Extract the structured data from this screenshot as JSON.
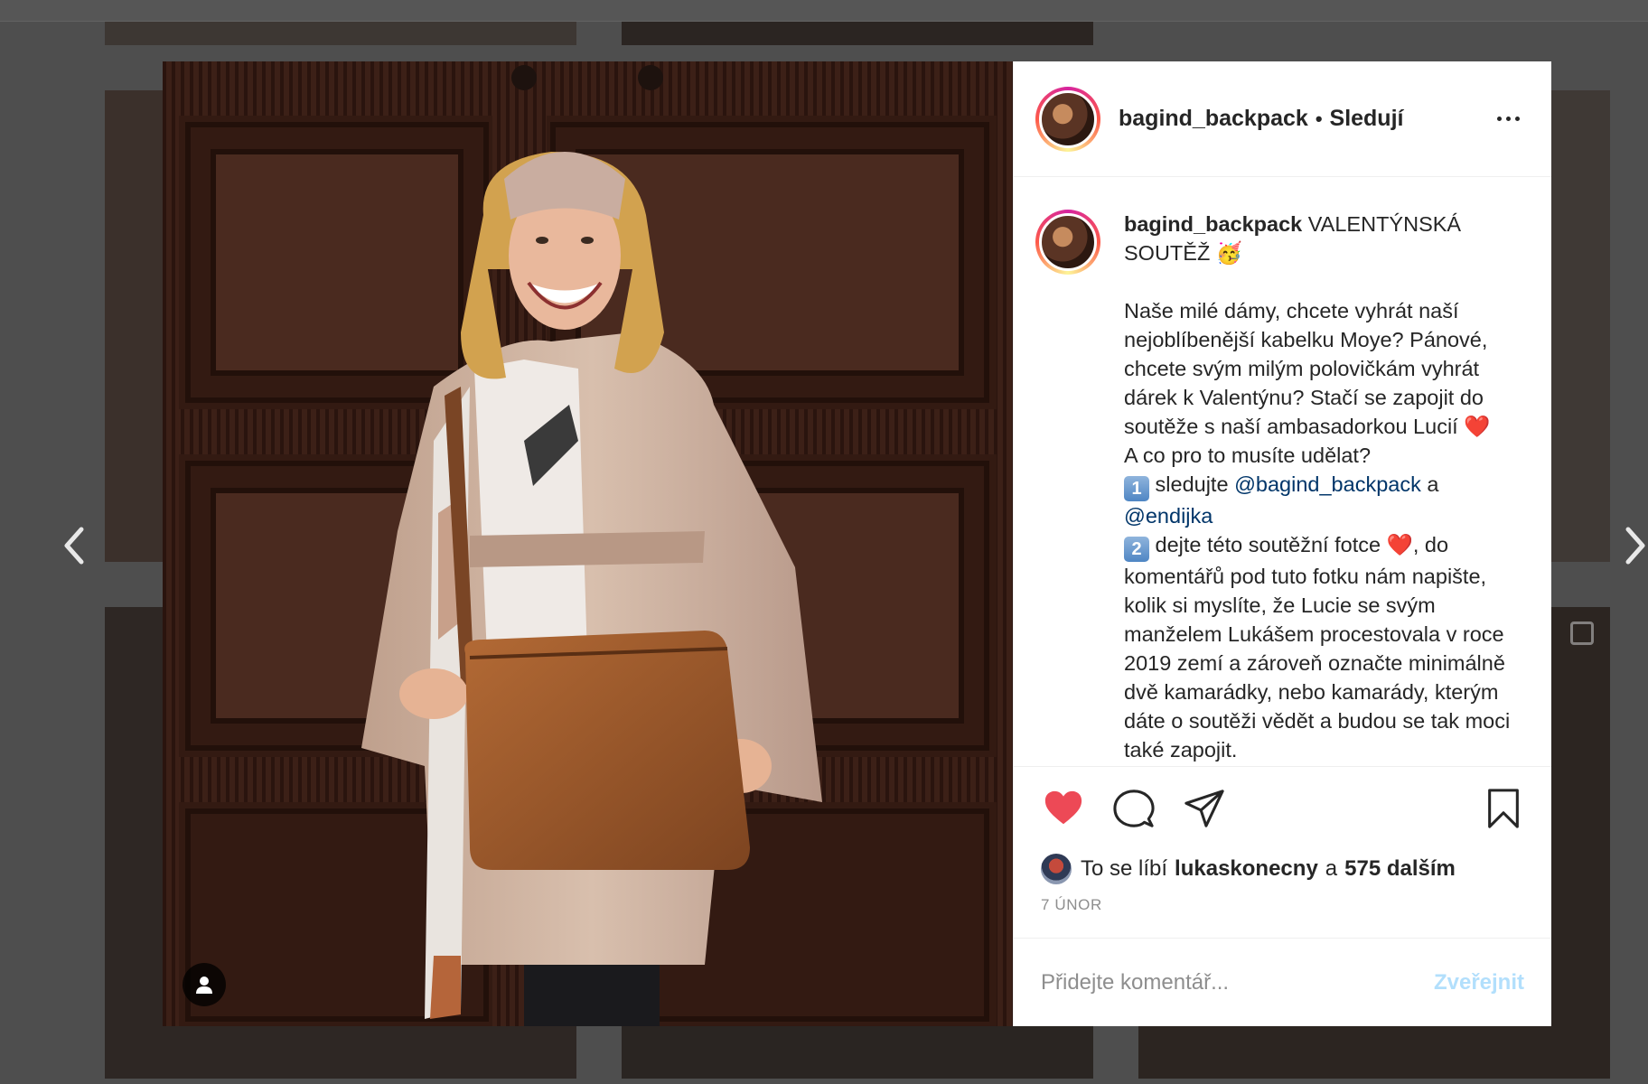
{
  "post": {
    "username": "bagind_backpack",
    "separator": "•",
    "follow_label": "Sledují",
    "caption_title": "VALENTÝNSKÁ SOUTĚŽ",
    "caption_title_emoji": "🥳",
    "caption_intro": "Naše milé dámy, chcete vyhrát naší nejoblíbenější kabelku Moye? Pánové, chcete svým milým polovičkám vyhrát dárek k Valentýnu? Stačí se zapojit do soutěže s naší ambasadorkou Lucií",
    "caption_question": "A co pro to musíte udělat?",
    "step1_key": "1",
    "step1_text": "sledujte",
    "step1_mention1": "@bagind_backpack",
    "step1_and": "a",
    "step1_mention2": "@endijka",
    "step2_key": "2",
    "step2_text_a": "dejte této soutěžní fotce",
    "step2_text_b": ", do komentářů pod tuto fotku nám napište, kolik si myslíte, že Lucie se svým manželem Lukášem procestovala v roce 2019 zemí a zároveň označte minimálně dvě kamarádky, nebo kamarády, kterým dáte o soutěži vědět a budou se tak moci také zapojit.",
    "heart_emoji": "❤️"
  },
  "likes": {
    "prefix": "To se líbí",
    "liker": "lukaskonecny",
    "conjunction": "a",
    "others": "575 dalším"
  },
  "date": "7 ÚNOR",
  "comment": {
    "placeholder": "Přidejte komentář...",
    "post_label": "Zveřejnit"
  },
  "icons": {
    "like": "heart-filled-icon",
    "comment": "comment-icon",
    "share": "share-icon",
    "save": "bookmark-icon",
    "tag": "user-tag-icon",
    "prev": "chevron-left-icon",
    "next": "chevron-right-icon"
  },
  "colors": {
    "like_red": "#ed4956",
    "mention_blue": "#003569",
    "post_button_disabled": "#b2dffc",
    "muted_text": "#8e8e8e"
  }
}
